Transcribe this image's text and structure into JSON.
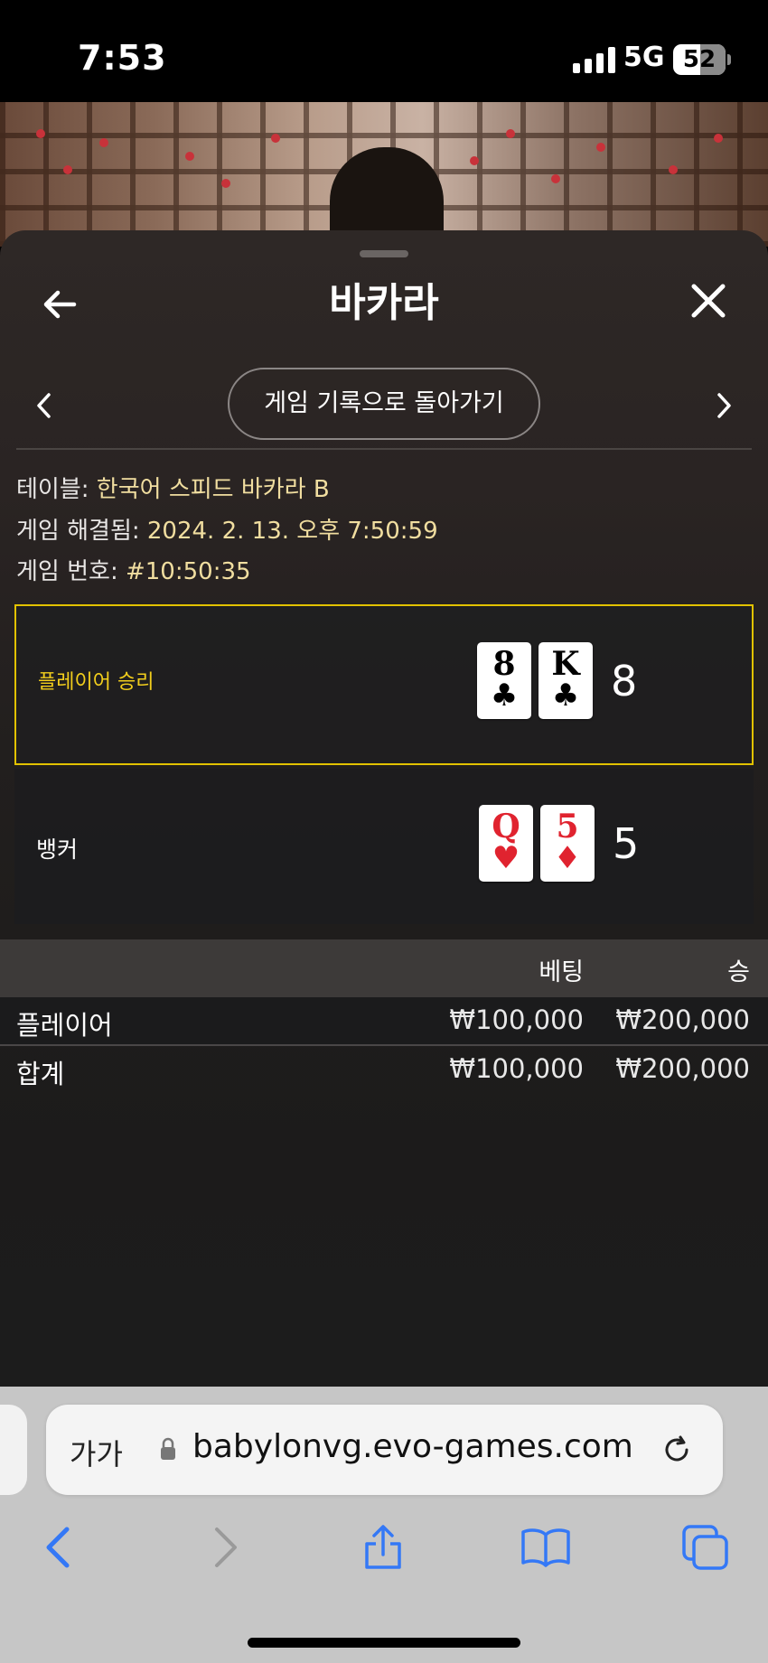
{
  "status": {
    "time": "7:53",
    "network": "5G",
    "battery": "52"
  },
  "header": {
    "title": "바카라"
  },
  "nav": {
    "history_label": "게임 기록으로 돌아가기"
  },
  "info": {
    "table_label": "테이블:",
    "table_value": "한국어 스피드 바카라 B",
    "resolved_label": "게임 해결됨:",
    "resolved_value": "2024. 2. 13. 오후 7:50:59",
    "number_label": "게임 번호:",
    "number_value": "#10:50:35"
  },
  "hands": {
    "player": {
      "label": "플레이어 승리",
      "score": "8",
      "cards": [
        {
          "rank": "8",
          "suit": "♣",
          "color": "black"
        },
        {
          "rank": "K",
          "suit": "♣",
          "color": "black"
        }
      ]
    },
    "banker": {
      "label": "뱅커",
      "score": "5",
      "cards": [
        {
          "rank": "Q",
          "suit": "♥",
          "color": "red"
        },
        {
          "rank": "5",
          "suit": "♦",
          "color": "red"
        }
      ]
    }
  },
  "bets": {
    "col_bet": "베팅",
    "col_win": "승",
    "rows": [
      {
        "name": "플레이어",
        "bet": "₩100,000",
        "win": "₩200,000"
      }
    ],
    "total": {
      "name": "합계",
      "bet": "₩100,000",
      "win": "₩200,000"
    }
  },
  "browser": {
    "aa": "가가",
    "url": "babylonvg.evo-games.com"
  },
  "colors": {
    "accent": "#e2c200",
    "win_label": "#f2ce1c",
    "info_value": "#f1dea0",
    "ios_blue": "#3478f6"
  }
}
